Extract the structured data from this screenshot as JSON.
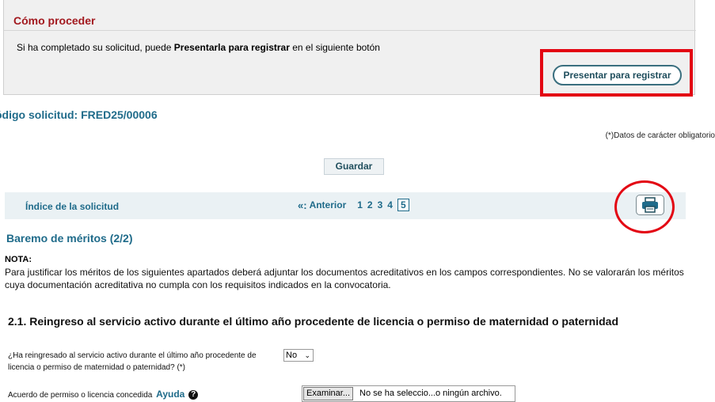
{
  "proceed": {
    "title": "Cómo proceder",
    "text_before": "Si ha completado su solicitud, puede ",
    "text_bold": "Presentarla para registrar",
    "text_after": " en el siguiente botón",
    "submit_button": "Presentar para registrar"
  },
  "request_code": "ódigo solicitud:  FRED25/00006",
  "required_note": "(*)Datos de carácter obligatorio",
  "save_button": "Guardar",
  "navigation": {
    "index_link": "Índice de la solicitud",
    "prev_arrows": "«:",
    "prev_label": "Anterior",
    "pages": [
      "1",
      "2",
      "3",
      "4"
    ],
    "current_page": "5"
  },
  "section": {
    "title": "Baremo de méritos (2/2)",
    "note_label": "NOTA:",
    "note_text": "Para justificar los méritos de los siguientes apartados deberá adjuntar los documentos acreditativos en los campos correspondientes. No se valorarán los méritos cuya documentación acreditativa no cumpla con los requisitos indicados en la convocatoria."
  },
  "subsection": {
    "title": "2.1. Reingreso al servicio activo durante el último año procedente de licencia o permiso de maternidad o paternidad",
    "question": "¿Ha reingresado al servicio activo durante el último año procedente de licencia o permiso de maternidad o paternidad? (*)",
    "answer": "No",
    "document_label": "Acuerdo de permiso o licencia concedida",
    "help_link": "Ayuda",
    "browse_button": "Examinar...",
    "file_status": "No se ha seleccio...o ningún archivo."
  }
}
